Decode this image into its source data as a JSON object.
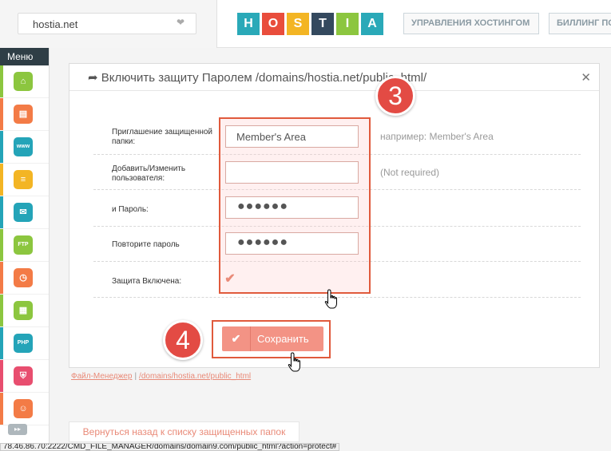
{
  "header": {
    "domain_select_value": "hostia.net",
    "logo_letters": [
      "H",
      "O",
      "S",
      "T",
      "I",
      "A"
    ],
    "logo_colors": [
      "#2aa9b8",
      "#e94d3c",
      "#f3b524",
      "#34495e",
      "#8cc63f",
      "#2aa9b8"
    ],
    "nav": [
      "УПРАВЛЕНИЯ ХОСТИНГОМ",
      "БИЛЛИНГ ПО"
    ]
  },
  "sidebar": {
    "title": "Меню",
    "items": [
      {
        "icon": "home-icon",
        "color": "#8cc63f",
        "glyph": "⌂"
      },
      {
        "icon": "file-manager-icon",
        "color": "#f37b46",
        "glyph": "▤"
      },
      {
        "icon": "www-icon",
        "color": "#24a4b8",
        "glyph": "www"
      },
      {
        "icon": "database-icon",
        "color": "#f3b524",
        "glyph": "≡"
      },
      {
        "icon": "mail-icon",
        "color": "#24a4b8",
        "glyph": "✉"
      },
      {
        "icon": "ftp-icon",
        "color": "#8cc63f",
        "glyph": "FTP"
      },
      {
        "icon": "clock-icon",
        "color": "#f37b46",
        "glyph": "◷"
      },
      {
        "icon": "calendar-icon",
        "color": "#8cc63f",
        "glyph": "▦"
      },
      {
        "icon": "php-icon",
        "color": "#24a4b8",
        "glyph": "PHP"
      },
      {
        "icon": "shield-icon",
        "color": "#e84e6f",
        "glyph": "⛨"
      },
      {
        "icon": "support-icon",
        "color": "#f37b46",
        "glyph": "☺"
      }
    ],
    "more_glyph": "▸▸"
  },
  "dialog": {
    "title": "➦ Включить защиту Паролем /domains/hostia.net/public_html/",
    "close_glyph": "✕",
    "rows": [
      {
        "label": "Приглашение защищенной папки:",
        "value": "Member's Area",
        "hint": "например: Member's Area"
      },
      {
        "label": "Добавить/Изменить пользователя:",
        "value": "",
        "hint": "(Not required)"
      },
      {
        "label": "и Пароль:",
        "value": "●●●●●●",
        "hint": ""
      },
      {
        "label": "Повторите пароль",
        "value": "●●●●●●",
        "hint": ""
      },
      {
        "label": "Защита Включена:",
        "value": "✔",
        "hint": ""
      }
    ],
    "save_check": "✔",
    "save_label": "Сохранить"
  },
  "steps": {
    "step3": "3",
    "step4": "4"
  },
  "breadcrumb": {
    "root": "Файл-Менеджер",
    "sep": "|",
    "path": "/domains/hostia.net/public_html"
  },
  "back_button": "Вернуться назад к списку защищенных папок",
  "statusbar": "78.46.86.70:2222/CMD_FILE_MANAGER/domains/domain9.com/public_html?action=protect#"
}
